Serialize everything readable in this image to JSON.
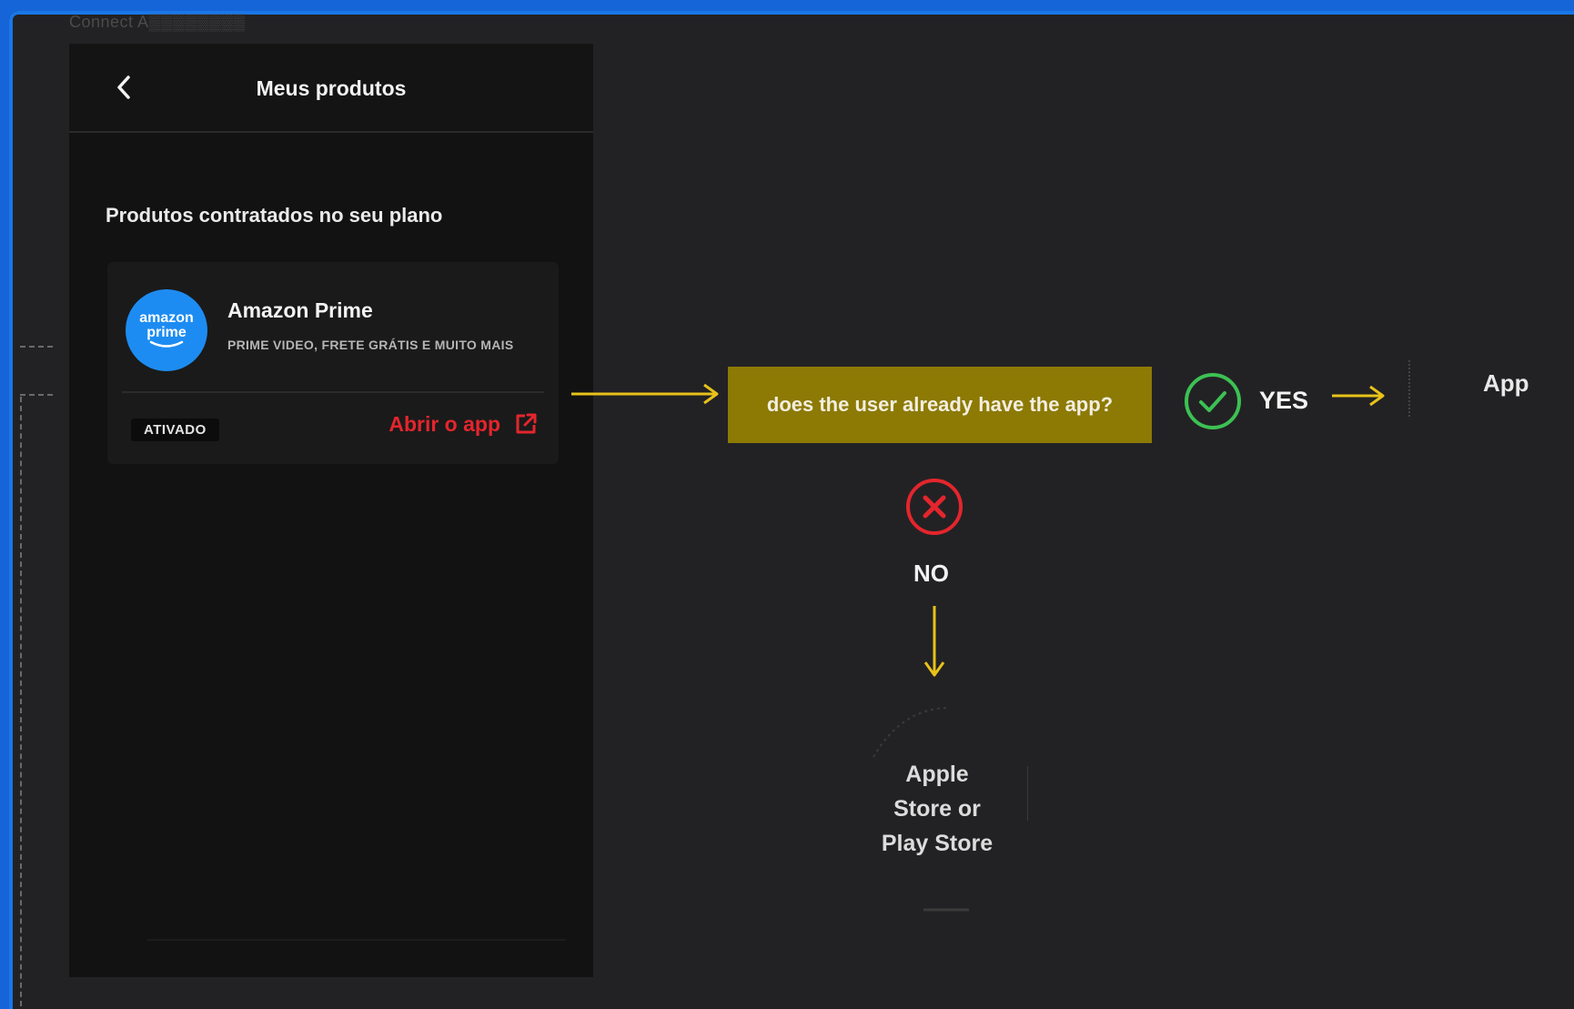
{
  "breadcrumb": "Connect A▒▒▒▒▒▒▒▒",
  "phone": {
    "header_title": "Meus produtos",
    "section_title": "Produtos contratados no seu plano",
    "product": {
      "logo_line1": "amazon",
      "logo_line2": "prime",
      "name": "Amazon Prime",
      "description": "PRIME VIDEO, FRETE GRÁTIS E MUITO MAIS",
      "status": "ATIVADO",
      "open_label": "Abrir o app"
    }
  },
  "flow": {
    "question": "does the user already have the app?",
    "yes_label": "YES",
    "yes_target": "App",
    "no_label": "NO",
    "no_target_line1": "Apple",
    "no_target_line2": "Store or",
    "no_target_line3": "Play Store"
  },
  "colors": {
    "accent_yellow": "#e8c21a",
    "question_bg": "#8c7a05",
    "yes_green": "#3cc153",
    "no_red": "#e4252d",
    "link_red": "#e4252d",
    "brand_blue": "#1d8cf2"
  },
  "icons": {
    "back": "chevron-left-icon",
    "external": "external-link-icon",
    "yes": "check-circle-icon",
    "no": "x-circle-icon"
  }
}
